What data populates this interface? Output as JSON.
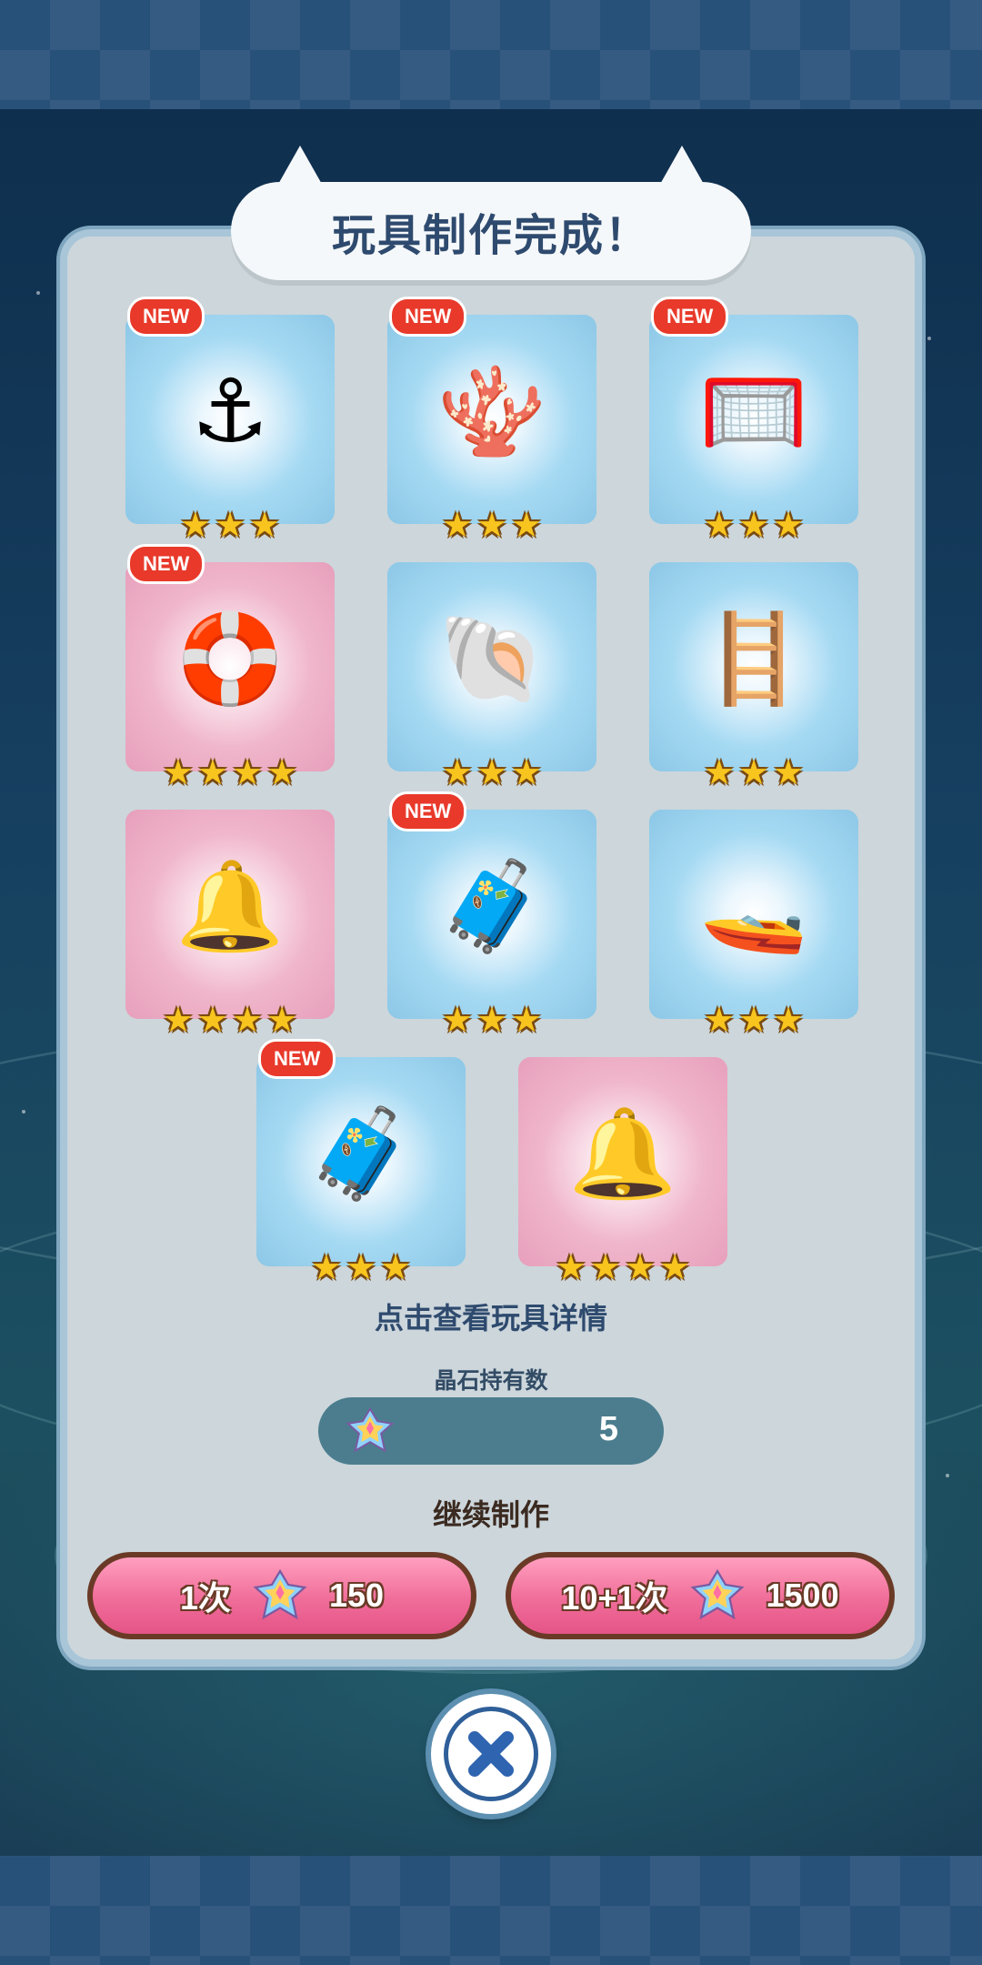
{
  "title": "玩具制作完成！",
  "new_label": "NEW",
  "toys": [
    {
      "name": "anchor",
      "glyph": "⚓",
      "rarity": "blue",
      "stars": 3,
      "is_new": true
    },
    {
      "name": "coral",
      "glyph": "🪸",
      "rarity": "blue",
      "stars": 3,
      "is_new": true
    },
    {
      "name": "soccer-goal",
      "glyph": "🥅",
      "rarity": "blue",
      "stars": 3,
      "is_new": true
    },
    {
      "name": "rainbow-swim-ring",
      "glyph": "🛟",
      "rarity": "pink",
      "stars": 4,
      "is_new": true
    },
    {
      "name": "seashell",
      "glyph": "🐚",
      "rarity": "blue",
      "stars": 3,
      "is_new": false
    },
    {
      "name": "diving-ladder",
      "glyph": "🪜",
      "rarity": "blue",
      "stars": 3,
      "is_new": false
    },
    {
      "name": "bell-arch",
      "glyph": "🔔",
      "rarity": "pink",
      "stars": 4,
      "is_new": false
    },
    {
      "name": "suitcase",
      "glyph": "🧳",
      "rarity": "blue",
      "stars": 3,
      "is_new": true
    },
    {
      "name": "jet-ski",
      "glyph": "🚤",
      "rarity": "blue",
      "stars": 3,
      "is_new": false
    },
    {
      "name": "suitcase",
      "glyph": "🧳",
      "rarity": "blue",
      "stars": 3,
      "is_new": true
    },
    {
      "name": "bell-arch",
      "glyph": "🔔",
      "rarity": "pink",
      "stars": 4,
      "is_new": false
    }
  ],
  "hint": "点击查看玩具详情",
  "owned": {
    "label": "晶石持有数",
    "count": "5"
  },
  "continue_label": "继续制作",
  "buttons": {
    "single": {
      "label": "1次",
      "cost": "150"
    },
    "multi": {
      "label": "10+1次",
      "cost": "1500"
    }
  },
  "colors": {
    "title": "#2e4a6e",
    "new_badge": "#e8392a",
    "button_pink": "#f06d99",
    "star": "#f7c51e"
  },
  "icons": {
    "gem": "rainbow-crystal-icon",
    "close": "close-icon",
    "star": "star-icon"
  }
}
